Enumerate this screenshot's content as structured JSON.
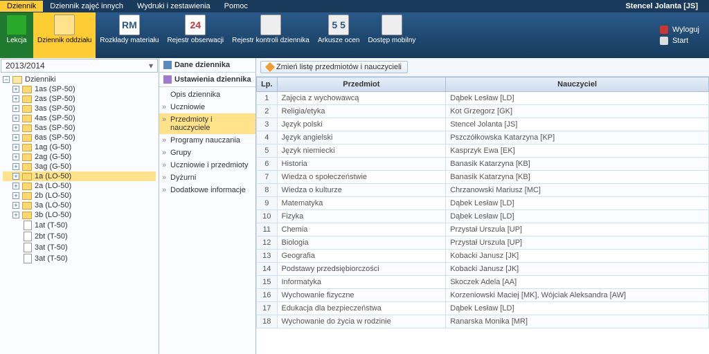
{
  "top_tabs": [
    "Dziennik",
    "Dziennik zajęć innych",
    "Wydruki i zestawienia",
    "Pomoc"
  ],
  "active_top_tab": 0,
  "username": "Stencel Jolanta [JS]",
  "ribbon": [
    {
      "label": "Lekcja",
      "icon": "green"
    },
    {
      "label": "Dziennik oddziału",
      "icon": "yellow"
    },
    {
      "label": "Rozkłady materiału",
      "icon": "rm",
      "text": "RM"
    },
    {
      "label": "Rejestr obserwacji",
      "icon": "cal",
      "text": "24"
    },
    {
      "label": "Rejestr kontroli dziennika",
      "icon": "plain"
    },
    {
      "label": "Arkusze ocen",
      "icon": "plain",
      "text": "5 5"
    },
    {
      "label": "Dostęp mobilny",
      "icon": "plain"
    }
  ],
  "active_ribbon": 1,
  "syslinks": {
    "logout": "Wyloguj",
    "start": "Start"
  },
  "year": "2013/2014",
  "tree_root": "Dzienniki",
  "tree": [
    {
      "label": "1as (SP-50)",
      "type": "folder",
      "exp": "+"
    },
    {
      "label": "2as (SP-50)",
      "type": "folder",
      "exp": "+"
    },
    {
      "label": "3as (SP-50)",
      "type": "folder",
      "exp": "+"
    },
    {
      "label": "4as (SP-50)",
      "type": "folder",
      "exp": "+"
    },
    {
      "label": "5as (SP-50)",
      "type": "folder",
      "exp": "+"
    },
    {
      "label": "6as (SP-50)",
      "type": "folder",
      "exp": "+"
    },
    {
      "label": "1ag (G-50)",
      "type": "folder",
      "exp": "+"
    },
    {
      "label": "2ag (G-50)",
      "type": "folder",
      "exp": "+"
    },
    {
      "label": "3ag (G-50)",
      "type": "folder",
      "exp": "+"
    },
    {
      "label": "1a (LO-50)",
      "type": "folder",
      "exp": "+",
      "selected": true
    },
    {
      "label": "2a (LO-50)",
      "type": "folder",
      "exp": "+"
    },
    {
      "label": "2b (LO-50)",
      "type": "folder",
      "exp": "+"
    },
    {
      "label": "3a (LO-50)",
      "type": "folder",
      "exp": "+"
    },
    {
      "label": "3b (LO-50)",
      "type": "folder",
      "exp": "+"
    },
    {
      "label": "1at (T-50)",
      "type": "file"
    },
    {
      "label": "2bt (T-50)",
      "type": "file"
    },
    {
      "label": "3at (T-50)",
      "type": "file"
    },
    {
      "label": "3at (T-50)",
      "type": "file"
    }
  ],
  "mid": {
    "header": "Dane dziennika",
    "sub": "Ustawienia dziennika",
    "items": [
      "Opis dziennika",
      "Uczniowie",
      "Przedmioty i nauczyciele",
      "Programy nauczania",
      "Grupy",
      "Uczniowie i przedmioty",
      "Dyżurni",
      "Dodatkowe informacje"
    ],
    "selected": 2
  },
  "toolbar_btn": "Zmień listę przedmiotów i nauczycieli",
  "table": {
    "cols": [
      "Lp.",
      "Przedmiot",
      "Nauczyciel"
    ],
    "rows": [
      {
        "n": 1,
        "p": "Zajęcia z wychowawcą",
        "t": "Dąbek Lesław [LD]"
      },
      {
        "n": 2,
        "p": "Religia/etyka",
        "t": "Kot Grzegorz [GK]"
      },
      {
        "n": 3,
        "p": "Język polski",
        "t": "Stencel Jolanta [JS]"
      },
      {
        "n": 4,
        "p": "Język angielski",
        "t": "Pszczółkowska Katarzyna [KP]"
      },
      {
        "n": 5,
        "p": "Język niemiecki",
        "t": "Kasprzyk Ewa [EK]"
      },
      {
        "n": 6,
        "p": "Historia",
        "t": "Banasik Katarzyna [KB]"
      },
      {
        "n": 7,
        "p": "Wiedza o społeczeństwie",
        "t": "Banasik Katarzyna [KB]"
      },
      {
        "n": 8,
        "p": "Wiedza o kulturze",
        "t": "Chrzanowski Mariusz [MC]"
      },
      {
        "n": 9,
        "p": "Matematyka",
        "t": "Dąbek Lesław [LD]"
      },
      {
        "n": 10,
        "p": "Fizyka",
        "t": "Dąbek Lesław [LD]"
      },
      {
        "n": 11,
        "p": "Chemia",
        "t": "Przystał Urszula [UP]"
      },
      {
        "n": 12,
        "p": "Biologia",
        "t": "Przystał Urszula [UP]"
      },
      {
        "n": 13,
        "p": "Geografia",
        "t": "Kobacki Janusz [JK]"
      },
      {
        "n": 14,
        "p": "Podstawy przedsiębiorczości",
        "t": "Kobacki Janusz [JK]"
      },
      {
        "n": 15,
        "p": "Informatyka",
        "t": "Skoczek Adela [AA]"
      },
      {
        "n": 16,
        "p": "Wychowanie fizyczne",
        "t": "Korzeniowski Maciej [MK], Wójciak Aleksandra [AW]"
      },
      {
        "n": 17,
        "p": "Edukacja dla bezpieczeństwa",
        "t": "Dąbek Lesław [LD]"
      },
      {
        "n": 18,
        "p": "Wychowanie do życia w rodzinie",
        "t": "Ranarska Monika [MR]"
      }
    ]
  }
}
